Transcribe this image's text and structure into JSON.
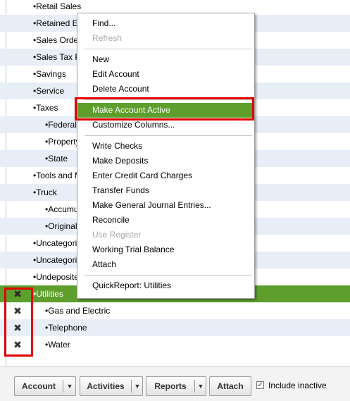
{
  "accounts": [
    {
      "name": "Retail Sales",
      "indent": 1,
      "alt": false,
      "selected": false,
      "inactive": false
    },
    {
      "name": "Retained Earnings",
      "indent": 1,
      "alt": true,
      "selected": false,
      "inactive": false
    },
    {
      "name": "Sales Orders",
      "indent": 1,
      "alt": false,
      "selected": false,
      "inactive": false
    },
    {
      "name": "Sales Tax Payable",
      "indent": 1,
      "alt": true,
      "selected": false,
      "inactive": false
    },
    {
      "name": "Savings",
      "indent": 1,
      "alt": false,
      "selected": false,
      "inactive": false
    },
    {
      "name": "Service",
      "indent": 1,
      "alt": true,
      "selected": false,
      "inactive": false
    },
    {
      "name": "Taxes",
      "indent": 1,
      "alt": false,
      "selected": false,
      "inactive": false
    },
    {
      "name": "Federal",
      "indent": 2,
      "alt": true,
      "selected": false,
      "inactive": false
    },
    {
      "name": "Property",
      "indent": 2,
      "alt": false,
      "selected": false,
      "inactive": false
    },
    {
      "name": "State",
      "indent": 2,
      "alt": true,
      "selected": false,
      "inactive": false
    },
    {
      "name": "Tools and Machinery",
      "indent": 1,
      "alt": false,
      "selected": false,
      "inactive": false
    },
    {
      "name": "Truck",
      "indent": 1,
      "alt": true,
      "selected": false,
      "inactive": false
    },
    {
      "name": "Accumulated Depreciation",
      "indent": 2,
      "alt": false,
      "selected": false,
      "inactive": false
    },
    {
      "name": "Original Cost",
      "indent": 2,
      "alt": true,
      "selected": false,
      "inactive": false
    },
    {
      "name": "Uncategorized Expenses",
      "indent": 1,
      "alt": false,
      "selected": false,
      "inactive": false
    },
    {
      "name": "Uncategorized Income",
      "indent": 1,
      "alt": true,
      "selected": false,
      "inactive": false
    },
    {
      "name": "Undeposited Funds",
      "indent": 1,
      "alt": false,
      "selected": false,
      "inactive": false
    },
    {
      "name": "Utilities",
      "indent": 1,
      "alt": false,
      "selected": true,
      "inactive": true
    },
    {
      "name": "Gas and Electric",
      "indent": 2,
      "alt": false,
      "selected": false,
      "inactive": true
    },
    {
      "name": "Telephone",
      "indent": 2,
      "alt": true,
      "selected": false,
      "inactive": true
    },
    {
      "name": "Water",
      "indent": 2,
      "alt": false,
      "selected": false,
      "inactive": true
    }
  ],
  "inactive_mark": "✖",
  "bullet": "•",
  "context_menu": [
    {
      "label": "Find...",
      "disabled": false,
      "highlight": false,
      "sep_after": false
    },
    {
      "label": "Refresh",
      "disabled": true,
      "highlight": false,
      "sep_after": true
    },
    {
      "label": "New",
      "disabled": false,
      "highlight": false,
      "sep_after": false
    },
    {
      "label": "Edit Account",
      "disabled": false,
      "highlight": false,
      "sep_after": false
    },
    {
      "label": "Delete Account",
      "disabled": false,
      "highlight": false,
      "sep_after": true
    },
    {
      "label": "Make Account Active",
      "disabled": false,
      "highlight": true,
      "sep_after": false
    },
    {
      "label": "Customize Columns...",
      "disabled": false,
      "highlight": false,
      "sep_after": true
    },
    {
      "label": "Write Checks",
      "disabled": false,
      "highlight": false,
      "sep_after": false
    },
    {
      "label": "Make Deposits",
      "disabled": false,
      "highlight": false,
      "sep_after": false
    },
    {
      "label": "Enter Credit Card Charges",
      "disabled": false,
      "highlight": false,
      "sep_after": false
    },
    {
      "label": "Transfer Funds",
      "disabled": false,
      "highlight": false,
      "sep_after": false
    },
    {
      "label": "Make General Journal Entries...",
      "disabled": false,
      "highlight": false,
      "sep_after": false
    },
    {
      "label": "Reconcile",
      "disabled": false,
      "highlight": false,
      "sep_after": false
    },
    {
      "label": "Use Register",
      "disabled": true,
      "highlight": false,
      "sep_after": false
    },
    {
      "label": "Working Trial Balance",
      "disabled": false,
      "highlight": false,
      "sep_after": false
    },
    {
      "label": "Attach",
      "disabled": false,
      "highlight": false,
      "sep_after": true
    },
    {
      "label": "QuickReport: Utilities",
      "disabled": false,
      "highlight": false,
      "sep_after": false
    }
  ],
  "toolbar": {
    "account_label": "Account",
    "activities_label": "Activities",
    "reports_label": "Reports",
    "attach_label": "Attach",
    "dropdown_arrow": "▼",
    "include_inactive_label": "Include inactive",
    "include_inactive_checked": true,
    "check_mark": "✓"
  },
  "colors": {
    "selection_green": "#5e9e2d",
    "alt_row": "#e8eef8",
    "annotation_red": "#e00000"
  }
}
